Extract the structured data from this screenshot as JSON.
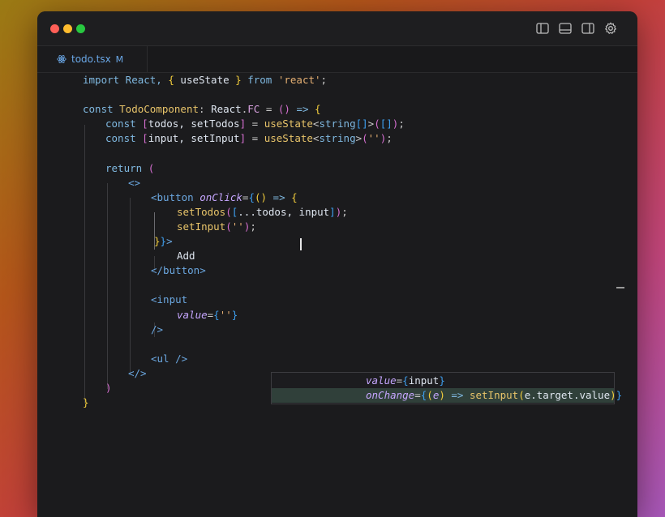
{
  "window": {
    "controls": [
      "close",
      "minimize",
      "zoom"
    ],
    "toolbar_icons": [
      "toggle-primary-sidebar-icon",
      "toggle-panel-icon",
      "toggle-secondary-sidebar-icon",
      "settings-gear-icon"
    ]
  },
  "tab": {
    "icon": "react-icon",
    "filename": "todo.tsx",
    "status": "M"
  },
  "code": [
    [
      "import React, ",
      "{",
      " useState ",
      "}",
      " from ",
      "'react'",
      ";"
    ],
    [
      ""
    ],
    [
      "const ",
      "TodoComponent",
      ": ",
      "React",
      ".",
      "FC",
      " = ",
      "()",
      " => ",
      "{"
    ],
    [
      "const ",
      "[",
      "todos, setTodos",
      "]",
      " = ",
      "useState",
      "<",
      "string",
      "[]",
      ">",
      "(",
      "[]",
      ")",
      ";"
    ],
    [
      "const ",
      "[",
      "input, setInput",
      "]",
      " = ",
      "useState",
      "<",
      "string",
      ">",
      "(",
      "''",
      ")",
      ";"
    ],
    [
      ""
    ],
    [
      "return ",
      "("
    ],
    [
      "<>"
    ],
    [
      "<button ",
      "onClick",
      "=",
      "{",
      "()",
      " => ",
      "{"
    ],
    [
      "setTodos",
      "(",
      "[",
      "...todos, input",
      "]",
      ")",
      ";"
    ],
    [
      "setInput",
      "(",
      "''",
      ")",
      ";"
    ],
    [
      "}",
      "}",
      ">"
    ],
    [
      "Add"
    ],
    [
      "</button>"
    ],
    [
      ""
    ],
    [
      "<input"
    ],
    [
      "value",
      "=",
      "{",
      "''",
      "}"
    ],
    [
      "/>"
    ],
    [
      ""
    ],
    [
      "<ul />"
    ],
    [
      "</>"
    ],
    [
      ")"
    ],
    [
      "}"
    ]
  ],
  "suggestion": {
    "line1": [
      "value",
      "=",
      "{",
      "input",
      "}"
    ],
    "line2": [
      "onChange",
      "=",
      "{",
      "(",
      "e",
      ")",
      " => ",
      "setInput",
      "(",
      "e.target.value",
      ")",
      "}"
    ]
  }
}
